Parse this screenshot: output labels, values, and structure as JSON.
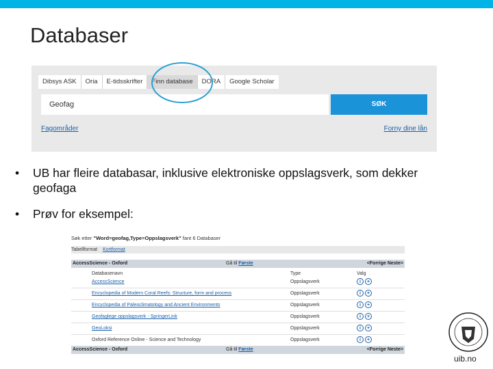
{
  "colors": {
    "accent": "#00b4e6",
    "search_button": "#1b93d9",
    "link": "#1a5fa8"
  },
  "slide": {
    "title": "Databaser"
  },
  "search_widget": {
    "tabs": [
      {
        "label": "Dibsys ASK",
        "active": false
      },
      {
        "label": "Oria",
        "active": false
      },
      {
        "label": "E-tidsskrifter",
        "active": false
      },
      {
        "label": "Finn database",
        "active": true
      },
      {
        "label": "DORA",
        "active": false
      },
      {
        "label": "Google Scholar",
        "active": false
      }
    ],
    "input_value": "Geofag",
    "search_button": "SØK",
    "link_left": "Fagområder",
    "link_right": "Forny dine lån"
  },
  "bullets": [
    "UB har fleire databasar, inklusive elektroniske oppslagsverk, som dekker geofaga",
    "Prøv for eksempel:"
  ],
  "results": {
    "query_prefix": "Søk etter",
    "query": "\"Word=geofag,Type=Oppslagsverk\"",
    "query_suffix": "fant 6 Databaser",
    "formats": [
      "Tabellformat",
      "Kortformat"
    ],
    "nav_left": "AccessScience - Oxford",
    "nav_goto": "Gå til",
    "nav_first": "Første",
    "nav_right": "<Forrige Neste>",
    "headers": {
      "name": "Databasenavn",
      "type": "Type",
      "valg": "Valg"
    },
    "rows": [
      {
        "name": "AccessScience",
        "type": "Oppslagsverk",
        "linked": true
      },
      {
        "name": "Encyclopedia of Modern Coral Reefs: Structure, form and process",
        "type": "Oppslagsverk",
        "linked": true
      },
      {
        "name": "Encyclopedia of Paleoclimatology and Ancient Environments",
        "type": "Oppslagsverk",
        "linked": true
      },
      {
        "name": "Geofaglege oppslagsverk - SpringerLink",
        "type": "Oppslagsverk",
        "linked": true
      },
      {
        "name": "GeoLoksi",
        "type": "Oppslagsverk",
        "linked": true
      },
      {
        "name": "Oxford Reference Online - Science and Technology",
        "type": "Oppslagsverk",
        "linked": false
      }
    ]
  },
  "footer": {
    "logo_text": "uib.no"
  }
}
